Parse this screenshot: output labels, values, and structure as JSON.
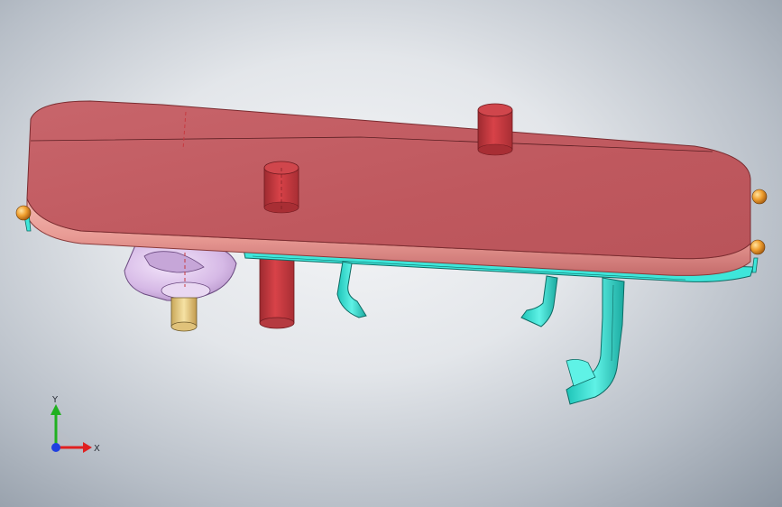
{
  "viewport": {
    "background_center": "#f4f5f7",
    "background_edge": "#8c96a2"
  },
  "model": {
    "parts": [
      {
        "name": "cover-plate",
        "color": "#c95c62"
      },
      {
        "name": "locating-pin",
        "color": "#c73a40"
      },
      {
        "name": "base-frame",
        "color": "#33e0d4"
      },
      {
        "name": "hook",
        "color": "#33e0d4"
      },
      {
        "name": "latch-lever",
        "color": "#33e0d4"
      },
      {
        "name": "knob-housing",
        "color": "#d9c0e6"
      },
      {
        "name": "knob-bushing",
        "color": "#ecd08a"
      },
      {
        "name": "corner-sphere",
        "color": "#f0a030"
      }
    ]
  },
  "triad": {
    "x_label": "X",
    "y_label": "Y",
    "x_color": "#e02020",
    "y_color": "#20b020",
    "z_color": "#1f3fe0"
  }
}
